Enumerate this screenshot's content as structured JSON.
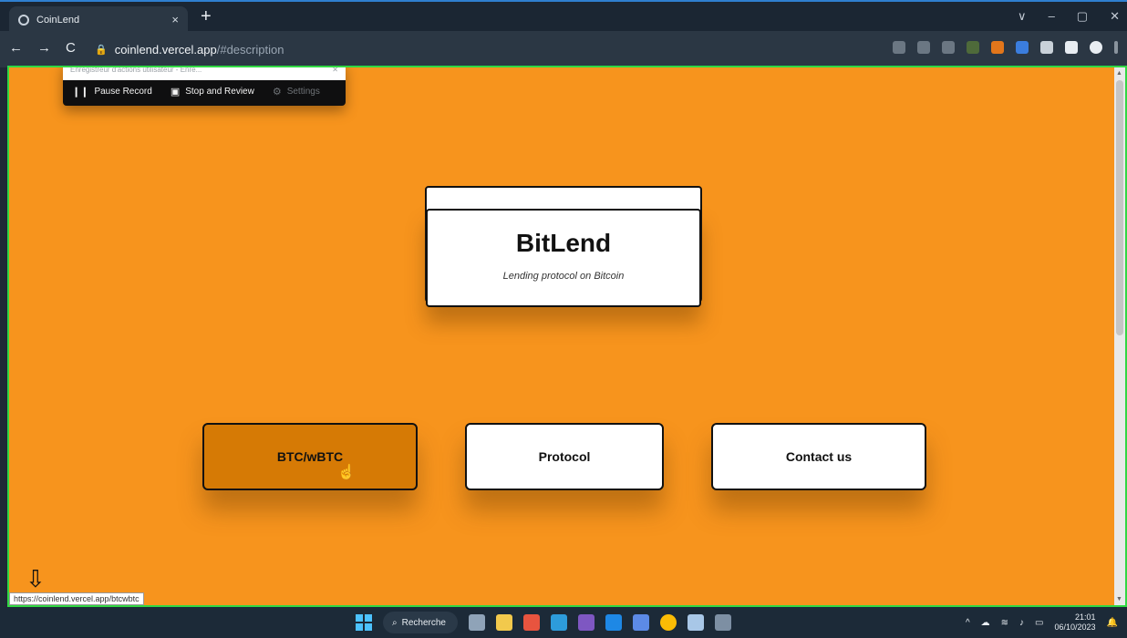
{
  "browser": {
    "tab_title": "CoinLend",
    "tab_close": "×",
    "new_tab": "+",
    "url_host": "coinlend.vercel.app",
    "url_path": "/#description",
    "nav_back": "←",
    "nav_forward": "→",
    "nav_reload": "C",
    "lock_icon": "🔒",
    "window_controls": [
      "∨",
      "–",
      "▢",
      "✕"
    ],
    "status_url": "https://coinlend.vercel.app/btcwbtc"
  },
  "recorder": {
    "title": "Enregistreur d'actions utilisateur - Enre...",
    "pause_label": "Pause Record",
    "stop_label": "Stop and Review",
    "settings_label": "Settings"
  },
  "hero": {
    "title": "BitLend",
    "subtitle": "Lending protocol on Bitcoin"
  },
  "actions": {
    "btc_label": "BTC/wBTC",
    "protocol_label": "Protocol",
    "contact_label": "Contact us"
  },
  "taskbar": {
    "search_label": "Recherche",
    "time": "21:01",
    "date": "06/10/2023"
  },
  "colors": {
    "page_bg": "#f7941d",
    "active_button": "#d67a05",
    "viewport_border": "#31d843"
  }
}
